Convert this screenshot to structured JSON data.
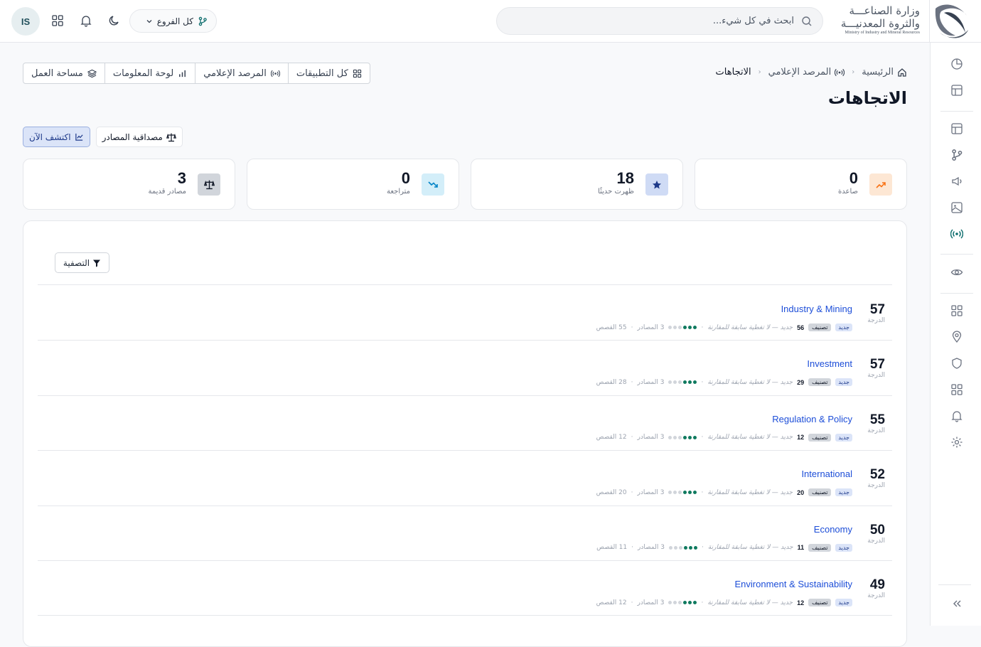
{
  "header": {
    "org_name_line1": "وزارة الصناعـــة",
    "org_name_line2": "والثروة المعدنيـــة",
    "org_name_en": "Ministry of Industry and Mineral Resources",
    "search_placeholder": "ابحث في كل شيء...",
    "branch_selector": "كل الفروع",
    "avatar_initials": "IS"
  },
  "breadcrumb": [
    "الرئيسية",
    "المرصد الإعلامي",
    "الاتجاهات"
  ],
  "page_title": "الاتجاهات",
  "app_nav": [
    "كل التطبيقات",
    "المرصد الإعلامي",
    "لوحة المعلومات",
    "مساحة العمل"
  ],
  "actions": {
    "source_credibility": "مصداقية المصادر",
    "discover_now": "اكتشف الآن"
  },
  "stats": [
    {
      "value": "0",
      "label": "صاعدة",
      "icon": "trending-up-icon",
      "color": "#f97316",
      "bg": "#fde7d4"
    },
    {
      "value": "18",
      "label": "ظهرت حديثًا",
      "icon": "star-icon",
      "color": "#1e3a8a",
      "bg": "#cfdbf5"
    },
    {
      "value": "0",
      "label": "متراجعة",
      "icon": "trending-down-icon",
      "color": "#0284c7",
      "bg": "#d3eef9"
    },
    {
      "value": "3",
      "label": "مصادر قديمة",
      "icon": "scale-icon",
      "color": "#111827",
      "bg": "#d1d5db"
    }
  ],
  "filter_label": "التصفية",
  "trends": [
    {
      "score": "57",
      "score_label": "الدرجة",
      "name": "Industry & Mining",
      "new_tag": "جديد",
      "class_tag": "تصنيف",
      "count": "56",
      "note": "جديد — لا تغطية سابقة للمقارنة",
      "sources": "3 المصادر",
      "stories": "55 القصص"
    },
    {
      "score": "57",
      "score_label": "الدرجة",
      "name": "Investment",
      "new_tag": "جديد",
      "class_tag": "تصنيف",
      "count": "29",
      "note": "جديد — لا تغطية سابقة للمقارنة",
      "sources": "3 المصادر",
      "stories": "28 القصص"
    },
    {
      "score": "55",
      "score_label": "الدرجة",
      "name": "Regulation & Policy",
      "new_tag": "جديد",
      "class_tag": "تصنيف",
      "count": "12",
      "note": "جديد — لا تغطية سابقة للمقارنة",
      "sources": "3 المصادر",
      "stories": "12 القصص"
    },
    {
      "score": "52",
      "score_label": "الدرجة",
      "name": "International",
      "new_tag": "جديد",
      "class_tag": "تصنيف",
      "count": "20",
      "note": "جديد — لا تغطية سابقة للمقارنة",
      "sources": "3 المصادر",
      "stories": "20 القصص"
    },
    {
      "score": "50",
      "score_label": "الدرجة",
      "name": "Economy",
      "new_tag": "جديد",
      "class_tag": "تصنيف",
      "count": "11",
      "note": "جديد — لا تغطية سابقة للمقارنة",
      "sources": "3 المصادر",
      "stories": "11 القصص"
    },
    {
      "score": "49",
      "score_label": "الدرجة",
      "name": "Environment & Sustainability",
      "new_tag": "جديد",
      "class_tag": "تصنيف",
      "count": "12",
      "note": "جديد — لا تغطية سابقة للمقارنة",
      "sources": "3 المصادر",
      "stories": "12 القصص"
    }
  ],
  "source_dots": {
    "filled": 3,
    "total": 6
  },
  "colors": {
    "accent": "#1d4ed8",
    "brand": "#1f4e5a",
    "active_sidebar": "#0f6e6e"
  }
}
